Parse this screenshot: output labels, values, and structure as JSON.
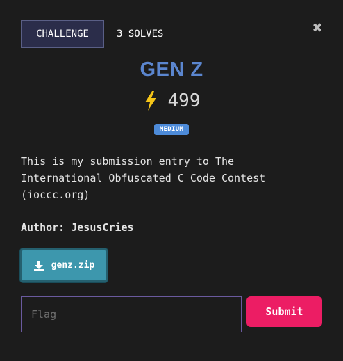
{
  "header": {
    "tab_challenge": "CHALLENGE",
    "tab_solves": "3 SOLVES"
  },
  "challenge": {
    "title": "GEN Z",
    "points": "499",
    "difficulty": "MEDIUM",
    "description_lines": [
      "This is my submission entry to The",
      "International Obfuscated C Code Contest",
      "(ioccc.org)"
    ],
    "author": "Author: JesusCries",
    "file_label": "genz.zip"
  },
  "form": {
    "flag_placeholder": "Flag",
    "submit_label": "Submit"
  },
  "icons": {
    "close": "close-icon",
    "points": "lightning-bolt-icon",
    "download": "download-icon"
  },
  "colors": {
    "title": "#5b86cf",
    "badge": "#4d8bd9",
    "file_button": "#3d97ad",
    "submit": "#ec1d64",
    "bolt": "#f5c518"
  }
}
